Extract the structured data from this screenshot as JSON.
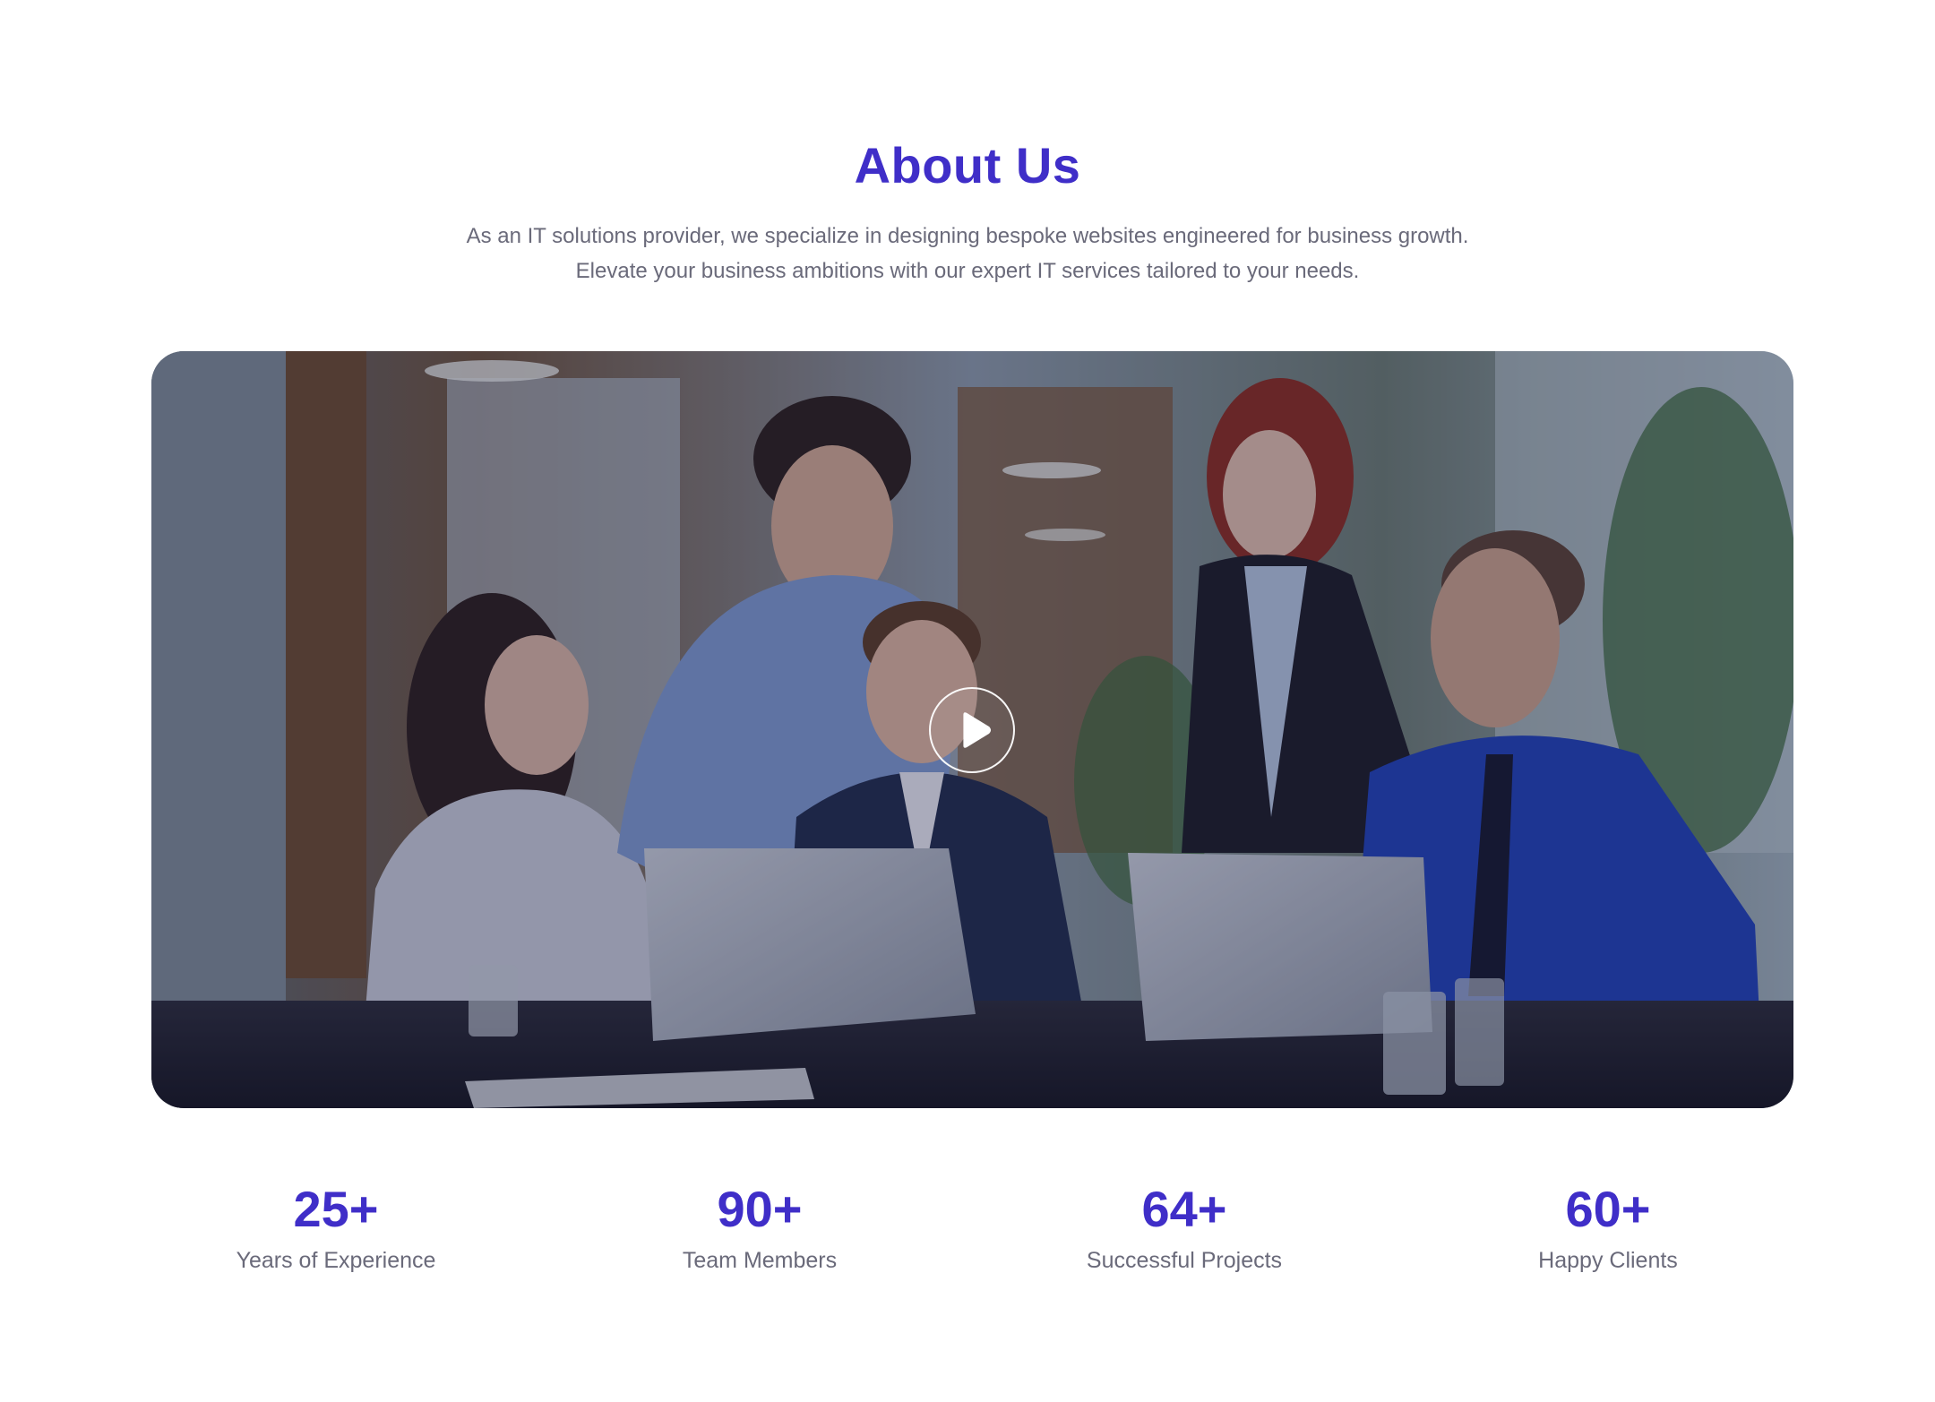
{
  "about": {
    "title": "About Us",
    "subtitle_line1": "As an IT solutions provider, we specialize in designing bespoke websites engineered for business growth.",
    "subtitle_line2": "Elevate your business ambitions with our expert IT services tailored to your needs."
  },
  "media": {
    "image_subject": "team of five professionals working around laptops in an office",
    "play_icon": "play-icon"
  },
  "stats": [
    {
      "value": "25+",
      "label": "Years of Experience"
    },
    {
      "value": "90+",
      "label": "Team Members"
    },
    {
      "value": "64+",
      "label": "Successful Projects"
    },
    {
      "value": "60+",
      "label": "Happy Clients"
    }
  ],
  "colors": {
    "accent": "#3f2ec8",
    "body_text": "#6a6a7a",
    "background": "#ffffff"
  }
}
